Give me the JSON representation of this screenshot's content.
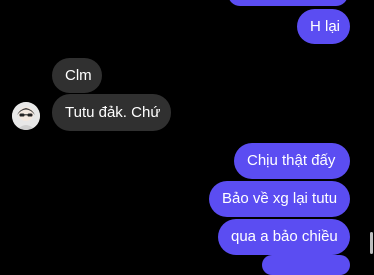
{
  "conversation": {
    "messages": [
      {
        "sender": "me",
        "text": ""
      },
      {
        "sender": "me",
        "text": "H lại"
      },
      {
        "sender": "them",
        "text": "Clm"
      },
      {
        "sender": "them",
        "text": "Tutu đảk. Chứ"
      },
      {
        "sender": "me",
        "text": "Chịu thật đấy"
      },
      {
        "sender": "me",
        "text": "Bảo về xg lại tutu"
      },
      {
        "sender": "me",
        "text": "qua a bảo chiều"
      },
      {
        "sender": "me",
        "text": ""
      }
    ]
  },
  "colors": {
    "background": "#000000",
    "incoming_bubble": "#303030",
    "outgoing_bubble": "#5b4df2",
    "text": "#ffffff"
  },
  "icons": {
    "contact_avatar": "avatar-icon"
  }
}
